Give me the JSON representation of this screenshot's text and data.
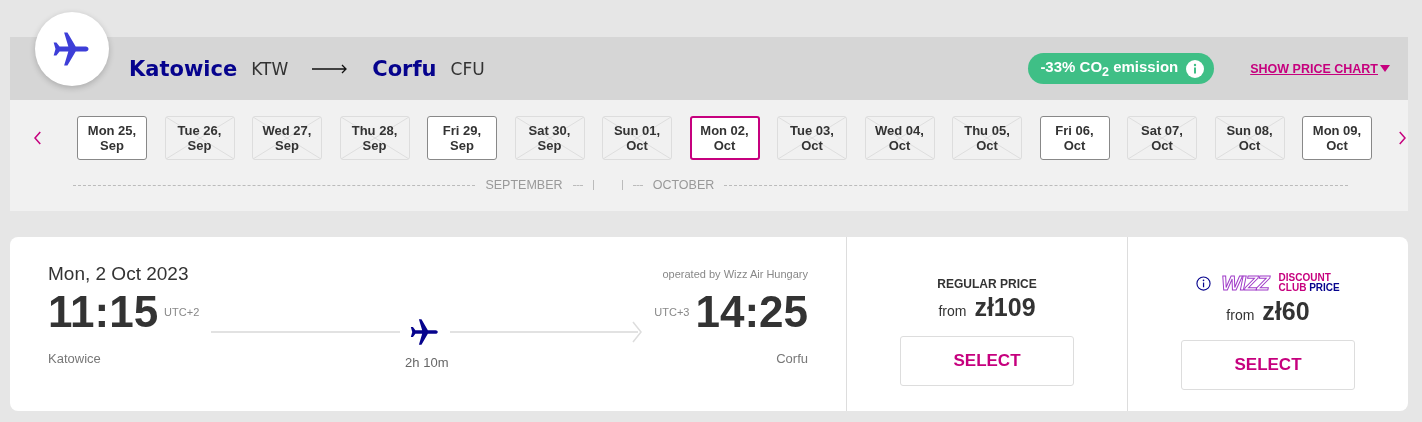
{
  "route": {
    "origin": {
      "city": "Katowice",
      "code": "KTW"
    },
    "destination": {
      "city": "Corfu",
      "code": "CFU"
    }
  },
  "co2_badge": "-33% CO$_{2}$ emission",
  "price_chart_link": "SHOW PRICE CHART",
  "dates": [
    {
      "weekday": "Mon 25,",
      "month": "Sep",
      "kind": "available",
      "selected": false
    },
    {
      "weekday": "Tue 26,",
      "month": "Sep",
      "kind": "unavailable",
      "selected": false
    },
    {
      "weekday": "Wed 27,",
      "month": "Sep",
      "kind": "unavailable",
      "selected": false
    },
    {
      "weekday": "Thu 28,",
      "month": "Sep",
      "kind": "unavailable",
      "selected": false
    },
    {
      "weekday": "Fri 29,",
      "month": "Sep",
      "kind": "available",
      "selected": false
    },
    {
      "weekday": "Sat 30,",
      "month": "Sep",
      "kind": "unavailable",
      "selected": false
    },
    {
      "weekday": "Sun 01,",
      "month": "Oct",
      "kind": "unavailable",
      "selected": false
    },
    {
      "weekday": "Mon 02,",
      "month": "Oct",
      "kind": "available",
      "selected": true
    },
    {
      "weekday": "Tue 03,",
      "month": "Oct",
      "kind": "unavailable",
      "selected": false
    },
    {
      "weekday": "Wed 04,",
      "month": "Oct",
      "kind": "unavailable",
      "selected": false
    },
    {
      "weekday": "Thu 05,",
      "month": "Oct",
      "kind": "unavailable",
      "selected": false
    },
    {
      "weekday": "Fri 06,",
      "month": "Oct",
      "kind": "available",
      "selected": false
    },
    {
      "weekday": "Sat 07,",
      "month": "Oct",
      "kind": "unavailable",
      "selected": false
    },
    {
      "weekday": "Sun 08,",
      "month": "Oct",
      "kind": "unavailable",
      "selected": false
    },
    {
      "weekday": "Mon 09,",
      "month": "Oct",
      "kind": "available",
      "selected": false
    }
  ],
  "months": [
    "SEPTEMBER",
    "OCTOBER"
  ],
  "flight": {
    "date": "Mon, 2 Oct 2023",
    "operator": "operated by Wizz Air Hungary",
    "departure": {
      "time": "11:15",
      "utc": "UTC+2",
      "city": "Katowice"
    },
    "arrival": {
      "time": "14:25",
      "utc": "UTC+3",
      "city": "Corfu"
    },
    "duration": "2h 10m"
  },
  "fares": [
    {
      "kind": "regular",
      "label": "REGULAR PRICE",
      "from": "from",
      "price": "zł109",
      "button": "SELECT"
    },
    {
      "kind": "club",
      "logo": "WIZZ",
      "label_top": "DISCOUNT",
      "label_bottom_1": "CLUB",
      "label_bottom_2": "PRICE",
      "from": "from",
      "price": "zł60",
      "button": "SELECT"
    }
  ]
}
